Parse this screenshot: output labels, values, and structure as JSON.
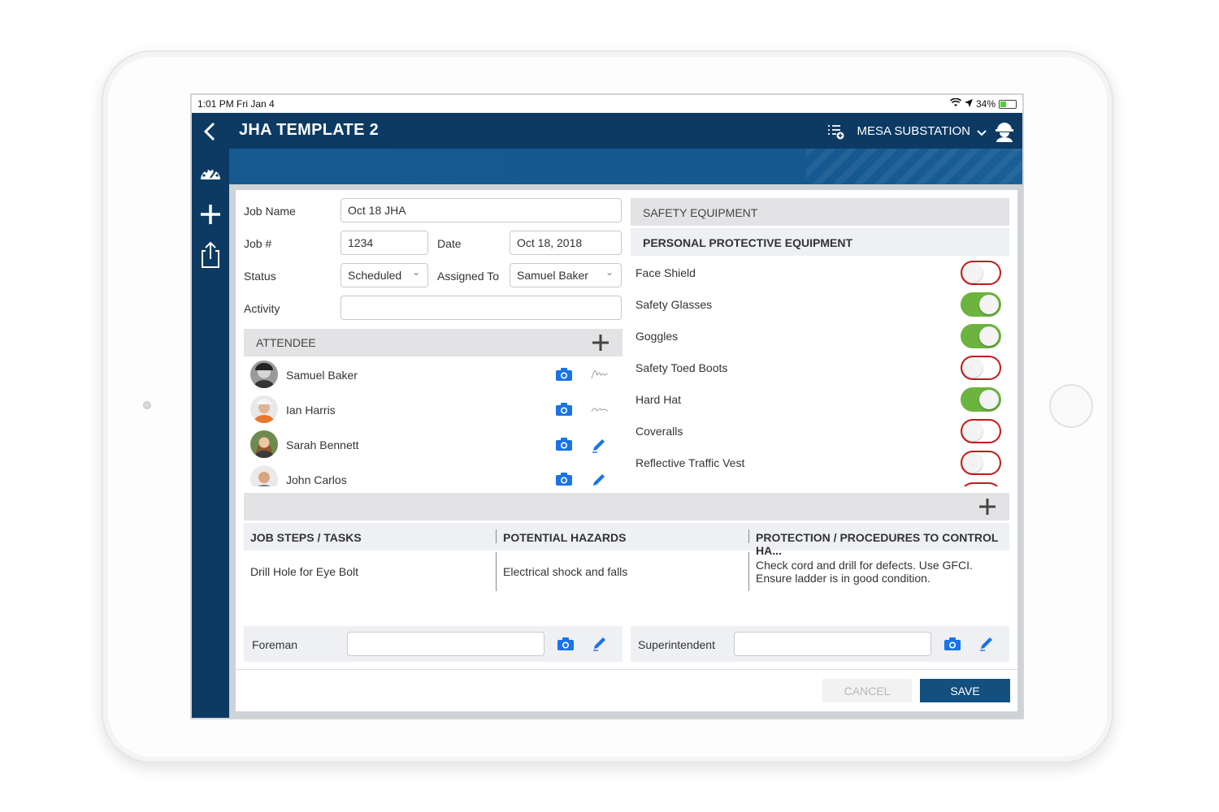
{
  "status_bar": {
    "time": "1:01 PM   Fri Jan 4",
    "battery": "34%"
  },
  "header": {
    "title": "JHA TEMPLATE 2",
    "site": "MESA SUBSTATION"
  },
  "form": {
    "job_name_label": "Job Name",
    "job_name_value": "Oct 18 JHA",
    "job_no_label": "Job #",
    "job_no_value": "1234",
    "date_label": "Date",
    "date_value": "Oct 18, 2018",
    "status_label": "Status",
    "status_value": "Scheduled",
    "assigned_label": "Assigned To",
    "assigned_value": "Samuel Baker",
    "activity_label": "Activity",
    "activity_value": ""
  },
  "attendees": {
    "header": "ATTENDEE",
    "items": [
      {
        "name": "Samuel Baker",
        "signature": "signed"
      },
      {
        "name": "Ian Harris",
        "signature": "signed"
      },
      {
        "name": "Sarah Bennett",
        "signature": "pencil"
      },
      {
        "name": "John Carlos",
        "signature": "pencil"
      }
    ]
  },
  "safety": {
    "header": "SAFETY EQUIPMENT",
    "subheader": "PERSONAL PROTECTIVE EQUIPMENT",
    "items": [
      {
        "label": "Face Shield",
        "on": false
      },
      {
        "label": "Safety Glasses",
        "on": true
      },
      {
        "label": "Goggles",
        "on": true
      },
      {
        "label": "Safety Toed Boots",
        "on": false
      },
      {
        "label": "Hard Hat",
        "on": true
      },
      {
        "label": "Coveralls",
        "on": false
      },
      {
        "label": "Reflective Traffic Vest",
        "on": false
      }
    ]
  },
  "steps": {
    "col1": "JOB STEPS / TASKS",
    "col2": "POTENTIAL HAZARDS",
    "col3": "PROTECTION / PROCEDURES TO CONTROL HA...",
    "row1_task": "Drill Hole for Eye Bolt",
    "row1_hazard": "Electrical shock and falls",
    "row1_protection_line1": "Check cord and drill for defects. Use GFCI.",
    "row1_protection_line2": "Ensure ladder is in good condition."
  },
  "signoff": {
    "foreman_label": "Foreman",
    "foreman_value": "",
    "super_label": "Superintendent",
    "super_value": ""
  },
  "buttons": {
    "cancel": "CANCEL",
    "save": "SAVE"
  },
  "colors": {
    "navy": "#0c3a63",
    "blue": "#175a91",
    "toggle_on": "#6cb33f",
    "toggle_off": "#c21a1a",
    "icon_blue": "#1a73e8"
  }
}
